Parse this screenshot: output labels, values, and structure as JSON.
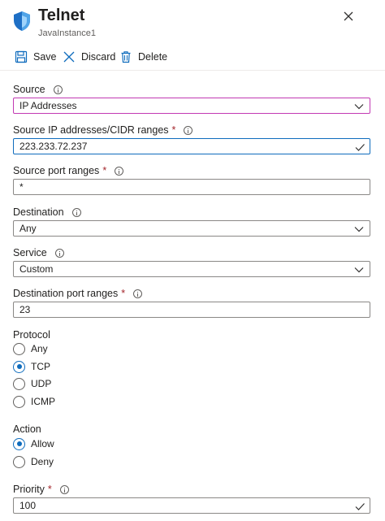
{
  "header": {
    "title": "Telnet",
    "subtitle": "JavaInstance1",
    "icon": "shield-icon",
    "accent": "#0f6cbd"
  },
  "toolbar": {
    "save_label": "Save",
    "discard_label": "Discard",
    "delete_label": "Delete"
  },
  "form": {
    "source": {
      "label": "Source",
      "value": "IP Addresses"
    },
    "source_ip": {
      "label": "Source IP addresses/CIDR ranges",
      "required_mark": "*",
      "value": "223.233.72.237"
    },
    "source_port": {
      "label": "Source port ranges",
      "required_mark": "*",
      "value": "*"
    },
    "destination": {
      "label": "Destination",
      "value": "Any"
    },
    "service": {
      "label": "Service",
      "value": "Custom"
    },
    "dest_port": {
      "label": "Destination port ranges",
      "required_mark": "*",
      "value": "23"
    },
    "protocol": {
      "label": "Protocol",
      "options": [
        "Any",
        "TCP",
        "UDP",
        "ICMP"
      ],
      "selected": "TCP"
    },
    "action": {
      "label": "Action",
      "options": [
        "Allow",
        "Deny"
      ],
      "selected": "Allow"
    },
    "priority": {
      "label": "Priority",
      "required_mark": "*",
      "value": "100"
    }
  }
}
